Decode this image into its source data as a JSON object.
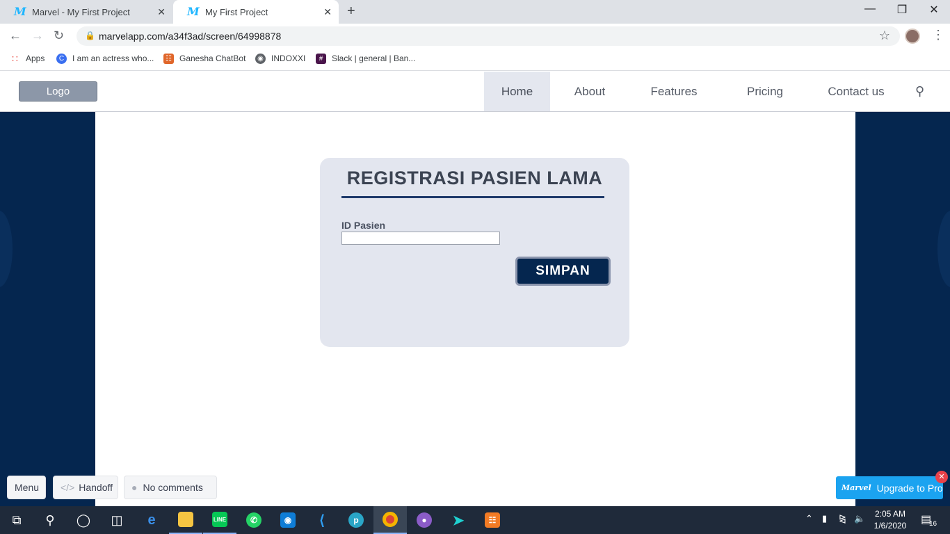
{
  "browser": {
    "tabs": [
      {
        "title": "Marvel - My First Project",
        "favicon": "marvel-icon"
      },
      {
        "title": "My First Project",
        "favicon": "marvel-icon"
      }
    ],
    "favicon_glyph": "M",
    "close_glyph": "✕",
    "new_tab_glyph": "+",
    "url": "marvelapp.com/a34f3ad/screen/64998878",
    "bookmarks": [
      {
        "label": "Apps",
        "icon": "apps-grid-icon"
      },
      {
        "label": "I am an actress who...",
        "icon": "c-icon"
      },
      {
        "label": "Ganesha ChatBot",
        "icon": "bot-icon"
      },
      {
        "label": "INDOXXI",
        "icon": "globe-icon"
      },
      {
        "label": "Slack | general | Ban...",
        "icon": "slack-icon"
      }
    ]
  },
  "site": {
    "logo": "Logo",
    "nav": [
      "Home",
      "About",
      "Features",
      "Pricing",
      "Contact us"
    ],
    "active_nav": "Home"
  },
  "form": {
    "title": "REGISTRASI PASIEN LAMA",
    "id_label": "ID Pasien",
    "id_value": "",
    "submit": "SIMPAN"
  },
  "marvel_bar": {
    "menu": "Menu",
    "handoff": "Handoff",
    "comments": "No comments",
    "upgrade": "Upgrade to Pro",
    "upgrade_brand": "Marvel"
  },
  "taskbar": {
    "time": "2:05 AM",
    "date": "1/6/2020",
    "notifications": "16"
  },
  "colors": {
    "navy": "#05264f",
    "card": "#e3e6ef",
    "marvel_blue": "#1ba3f0"
  }
}
